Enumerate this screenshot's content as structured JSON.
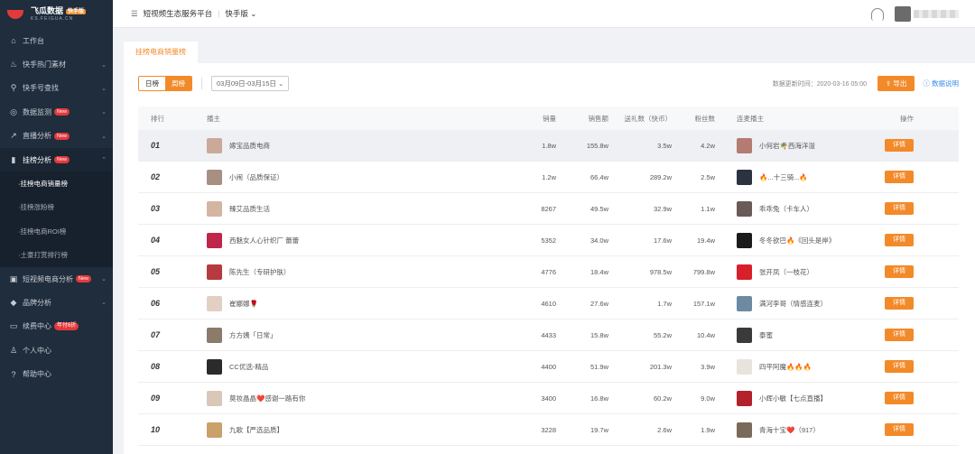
{
  "brand": {
    "name": "飞瓜数据",
    "badge": "快手版",
    "domain": "KS.FEIGUA.CN"
  },
  "topbar": {
    "platform": "短视频生态服务平台",
    "version": "快手版"
  },
  "sidebar": {
    "items": [
      {
        "label": "工作台",
        "icon": "home-icon"
      },
      {
        "label": "快手热门素材",
        "icon": "fire-icon"
      },
      {
        "label": "快手号查找",
        "icon": "search-icon"
      },
      {
        "label": "数据监测",
        "icon": "monitor-icon",
        "badge": "New"
      },
      {
        "label": "直播分析",
        "icon": "trend-icon",
        "badge": "New"
      },
      {
        "label": "挂榜分析",
        "icon": "bar-chart-icon",
        "badge": "New"
      },
      {
        "label": "短视频电商分析",
        "icon": "shop-icon",
        "badge": "New"
      },
      {
        "label": "品牌分析",
        "icon": "diamond-icon"
      },
      {
        "label": "续费中心",
        "icon": "card-icon",
        "badge": "年付6折"
      },
      {
        "label": "个人中心",
        "icon": "user-icon"
      },
      {
        "label": "帮助中心",
        "icon": "help-icon"
      }
    ],
    "sub_items": [
      "挂榜电商销量榜",
      "挂榜涨粉榜",
      "挂榜电商ROI榜",
      "土豪打赏排行榜"
    ]
  },
  "tab": {
    "label": "挂榜电商销量榜"
  },
  "filters": {
    "daily": "日榜",
    "weekly": "周榜",
    "date_range": "03月09日-03月15日",
    "update_time": "数据更新时间：2020-03-16 05:00",
    "export_label": "导出",
    "explain_label": "数据说明"
  },
  "table": {
    "headers": {
      "rank": "排行",
      "anchor": "播主",
      "sales": "销量",
      "amount": "销售额",
      "gift": "送礼数（快币）",
      "fans": "粉丝数",
      "co_anchor": "连麦播主",
      "op": "操作"
    },
    "detail_label": "详情",
    "rows": [
      {
        "rank": "01",
        "name": "嫁宝品质电商",
        "sales": "1.8w",
        "amount": "155.8w",
        "gift": "3.5w",
        "fans": "4.2w",
        "co": "小何岩🌴西海洋溢",
        "color": "#c9a99a",
        "co_color": "#b47b72"
      },
      {
        "rank": "02",
        "name": "小闹（品质保证）",
        "sales": "1.2w",
        "amount": "66.4w",
        "gift": "289.2w",
        "fans": "2.5w",
        "co": "🔥...十三骑...🔥",
        "color": "#a78f84",
        "co_color": "#2c3340"
      },
      {
        "rank": "03",
        "name": "臻艾品质生活",
        "sales": "8267",
        "amount": "49.5w",
        "gift": "32.9w",
        "fans": "1.1w",
        "co": "乖乖兔（卡车人）",
        "color": "#d3b5a2",
        "co_color": "#6a5b58"
      },
      {
        "rank": "04",
        "name": "西魅女人心针织厂 蕾蕾",
        "sales": "5352",
        "amount": "34.0w",
        "gift": "17.6w",
        "fans": "19.4w",
        "co": "冬冬欲巴🔥《回头是岸》",
        "color": "#c0254a",
        "co_color": "#1b1b1b"
      },
      {
        "rank": "05",
        "name": "陈先生（专研护肤）",
        "sales": "4776",
        "amount": "18.4w",
        "gift": "978.5w",
        "fans": "799.8w",
        "co": "张开凤（一枝花）",
        "color": "#b63a3f",
        "co_color": "#d8202a"
      },
      {
        "rank": "06",
        "name": "崔娜娜🌹",
        "sales": "4610",
        "amount": "27.6w",
        "gift": "1.7w",
        "fans": "157.1w",
        "co": "满河李哥（情感连麦）",
        "color": "#e3cfc3",
        "co_color": "#6d8aa3"
      },
      {
        "rank": "07",
        "name": "方方姨「日常」",
        "sales": "4433",
        "amount": "15.8w",
        "gift": "55.2w",
        "fans": "10.4w",
        "co": "泰蜜",
        "color": "#8a7b6a",
        "co_color": "#3a3a3a"
      },
      {
        "rank": "08",
        "name": "CC优选-精品",
        "sales": "4400",
        "amount": "51.9w",
        "gift": "201.3w",
        "fans": "3.9w",
        "co": "四平阿魔🔥🔥🔥",
        "color": "#2b2b2b",
        "co_color": "#e9e3dd"
      },
      {
        "rank": "09",
        "name": "莫妆晶晶❤️感谢一路有你",
        "sales": "3400",
        "amount": "16.8w",
        "gift": "60.2w",
        "fans": "9.0w",
        "co": "小辉小敏【七点直播】",
        "color": "#d9c8b8",
        "co_color": "#b3212b"
      },
      {
        "rank": "10",
        "name": "九歌【严选品质】",
        "sales": "3228",
        "amount": "19.7w",
        "gift": "2.6w",
        "fans": "1.9w",
        "co": "青海十宝❤️（917）",
        "color": "#c9a16b",
        "co_color": "#7a6a5c"
      }
    ]
  }
}
